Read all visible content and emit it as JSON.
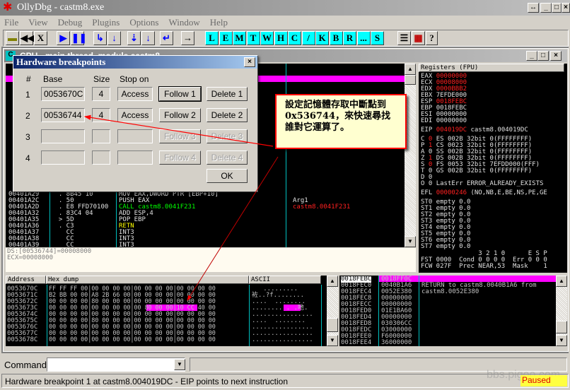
{
  "app": {
    "title": "OllyDbg - castm8.exe",
    "menu": [
      "File",
      "View",
      "Debug",
      "Plugins",
      "Options",
      "Window",
      "Help"
    ],
    "toolbar_letters": [
      "L",
      "E",
      "M",
      "T",
      "W",
      "H",
      "C",
      "/",
      "K",
      "B",
      "R",
      "...",
      "S"
    ]
  },
  "cpu": {
    "title": "CPU - main thread, module castm8",
    "disasm": [
      [
        "00401A29",
        "  . 8B45 10",
        "MOV EAX,DWORD PTR [EBP+10]",
        "wht"
      ],
      [
        "00401A2C",
        "  . 50",
        "PUSH EAX",
        "wht"
      ],
      [
        "00401A2D",
        "  . E8 FFD70100",
        "CALL castm8.0041F231",
        "grn"
      ],
      [
        "00401A32",
        "  . 83C4 04",
        "ADD ESP,4",
        "wht"
      ],
      [
        "00401A35",
        "  > 5D",
        "POP EBP",
        "wht"
      ],
      [
        "00401A36",
        "  . C3",
        "RETN",
        "yel"
      ],
      [
        "00401A37",
        "    CC",
        "INT3",
        "wht"
      ],
      [
        "00401A38",
        "    CC",
        "INT3",
        "wht"
      ],
      [
        "00401A39",
        "    CC",
        "INT3",
        "wht"
      ]
    ],
    "comment_arg": "Arg1",
    "comment_call": "castm8.0041F231",
    "info": [
      "DS:[00536744]=00008000",
      "ECX=00008000"
    ],
    "registers_title": "Registers (FPU)",
    "registers": [
      [
        "EAX",
        "00000000",
        1
      ],
      [
        "ECX",
        "00008000",
        1
      ],
      [
        "EDX",
        "0000BBB2",
        1
      ],
      [
        "EBX",
        "7EFDE000",
        0
      ],
      [
        "ESP",
        "0018FEBC",
        1
      ],
      [
        "EBP",
        "0018FEBC",
        0
      ],
      [
        "ESI",
        "00000000",
        0
      ],
      [
        "EDI",
        "00000000",
        0
      ]
    ],
    "eip": [
      "EIP",
      "004019DC",
      "castm8.004019DC"
    ],
    "flags": [
      [
        "C",
        "0",
        1,
        "ES 002B 32bit 0(FFFFFFFF)"
      ],
      [
        "P",
        "1",
        1,
        "CS 0023 32bit 0(FFFFFFFF)"
      ],
      [
        "A",
        "0",
        0,
        "SS 002B 32bit 0(FFFFFFFF)"
      ],
      [
        "Z",
        "1",
        1,
        "DS 002B 32bit 0(FFFFFFFF)"
      ],
      [
        "S",
        "0",
        1,
        "FS 0053 32bit 7EFDD000(FFF)"
      ],
      [
        "T",
        "0",
        0,
        "GS 002B 32bit 0(FFFFFFFF)"
      ],
      [
        "D",
        "0",
        0,
        ""
      ],
      [
        "O",
        "0",
        0,
        "LastErr ERROR_ALREADY_EXISTS"
      ]
    ],
    "efl": [
      "EFL",
      "00000246",
      "(NO,NB,E,BE,NS,PE,GE"
    ],
    "fpu": [
      "ST0 empty 0.0",
      "ST1 empty 0.0",
      "ST2 empty 0.0",
      "ST3 empty 0.0",
      "ST4 empty 0.0",
      "ST5 empty 0.0",
      "ST6 empty 0.0",
      "ST7 empty 0.0",
      "               3 2 1 0      E S P",
      "FST 0000  Cond 0 0 0 0  Err 0 0 0",
      "FCW 027F  Prec NEAR,53  Mask    1"
    ],
    "dump_headers": [
      "Address",
      "Hex dump",
      "ASCII"
    ],
    "dump": [
      [
        "0053670C",
        "FF FF FF 00|00 00 00 00|00 00 00 00|00 00 00 00",
        "   ........."
      ],
      [
        "0053671C",
        "B2 BB 00 00|A8 2B 66 00|00 00 00 00|00 00 00 00",
        "袏..?f........"
      ],
      [
        "0053672C",
        "00 00 00 00|80 00 00 00|00 00 00 00|00 00 00 00",
        "....  ........"
      ],
      [
        "0053673C",
        "00 00 00 00|00 00 00 00|00 80 00 00|10 CC 40 00",
        "........ . .吔."
      ],
      [
        "0053674C",
        "00 00 00 00|00 00 00 00|00 00 00 00|00 00 00 00",
        "................"
      ],
      [
        "0053675C",
        "00 00 00 00|80 00 00 00|00 00 00 00|00 00 00 00",
        "....  ........"
      ],
      [
        "0053676C",
        "00 00 00 00|00 00 00 00|00 00 00 00|00 00 00 00",
        "................"
      ],
      [
        "0053677C",
        "00 00 00 00|00 00 00 00|00 00 00 00|00 00 00 00",
        "................"
      ],
      [
        "0053678C",
        "00 00 00 00|00 00 00 00|00 00 00 00|00 00 00 00",
        "................"
      ]
    ],
    "stack": [
      [
        "0018FEBC",
        "0018FF0C",
        ""
      ],
      [
        "0018FEC0",
        "0040B1A6",
        "RETURN to castm8.0040B1A6 from"
      ],
      [
        "0018FEC4",
        "0052E380",
        "castm8.0052E380"
      ],
      [
        "0018FEC8",
        "00000000",
        ""
      ],
      [
        "0018FECC",
        "00000000",
        ""
      ],
      [
        "0018FED0",
        "01E1BA60",
        ""
      ],
      [
        "0018FED4",
        "00000000",
        ""
      ],
      [
        "0018FED8",
        "030306CC",
        ""
      ],
      [
        "0018FEDC",
        "03000000",
        ""
      ],
      [
        "0018FEE0",
        "F6000000",
        ""
      ],
      [
        "0018FEE4",
        "36000000",
        ""
      ]
    ]
  },
  "dialog": {
    "title": "Hardware breakpoints",
    "headers": [
      "#",
      "Base",
      "Size",
      "Stop on"
    ],
    "rows": [
      [
        "1",
        "0053670C",
        "4",
        "Access",
        "Follow 1",
        "Delete 1",
        true
      ],
      [
        "2",
        "00536744",
        "4",
        "Access",
        "Follow 2",
        "Delete 2",
        true
      ],
      [
        "3",
        "",
        "",
        "",
        "Follow 3",
        "Delete 3",
        false
      ],
      [
        "4",
        "",
        "",
        "",
        "Follow 4",
        "Delete 4",
        false
      ]
    ],
    "ok": "OK"
  },
  "callout": "設定記憶體存取中斷點到 0x536744，來快速尋找誰對它運算了。",
  "command": {
    "label": "Command",
    "value": ""
  },
  "status": {
    "message": "Hardware breakpoint 1 at castm8.004019DC - EIP points to next instruction",
    "state": "Paused",
    "watermark": "bbs.pigoo.com"
  },
  "colors": {
    "highlight": "#ff00ff",
    "accent": "#00ffff",
    "paused_bg": "#ffff40"
  }
}
